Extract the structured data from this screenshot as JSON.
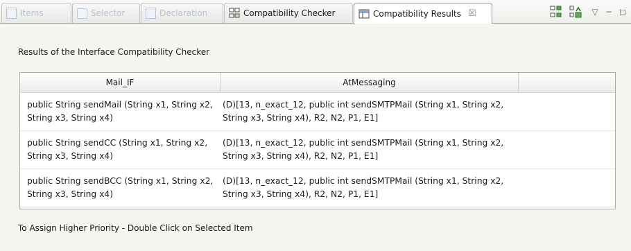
{
  "tabs": [
    {
      "label": "Items",
      "icon": "document-icon",
      "faded": true
    },
    {
      "label": "Selector",
      "icon": "selector-icon",
      "faded": true
    },
    {
      "label": "Declaration",
      "icon": "declaration-icon",
      "faded": true
    },
    {
      "label": "Compatibility Checker",
      "icon": "checker-icon",
      "faded": false
    },
    {
      "label": "Compatibility Results",
      "icon": "results-icon",
      "faded": false,
      "active": true,
      "close": "☒"
    }
  ],
  "toolbar": {
    "minimize": "−",
    "maximize": "◻",
    "menu": "▽"
  },
  "description": "Results of the Interface Compatibility Checker",
  "table": {
    "columns": [
      "Mail_IF",
      "AtMessaging"
    ],
    "rows": [
      {
        "interface": "public String sendMail (String x1, String x2, String x3, String x4)",
        "match": "(D)[13, n_exact_12, public int sendSMTPMail (String x1, String x2, String x3, String x4), R2, N2, P1, E1]"
      },
      {
        "interface": "public String sendCC (String x1, String x2, String x3, String x4)",
        "match": "(D)[13, n_exact_12, public int sendSMTPMail (String x1, String x2, String x3, String x4), R2, N2, P1, E1]"
      },
      {
        "interface": "public String sendBCC (String x1, String x2, String x3, String x4)",
        "match": "(D)[13, n_exact_12, public int sendSMTPMail (String x1, String x2, String x3, String x4), R2, N2, P1, E1]"
      }
    ]
  },
  "hint": "To Assign Higher Priority - Double Click on Selected Item",
  "colors": {
    "accent": "#2f6fd6",
    "background": "#f6f5ef"
  }
}
